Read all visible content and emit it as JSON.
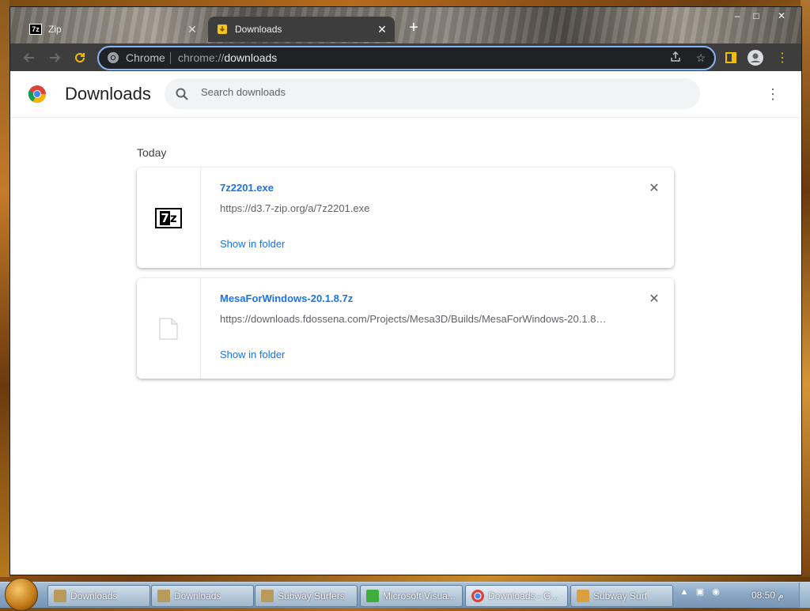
{
  "browser": {
    "tabs": [
      {
        "title": "Zip",
        "active": false
      },
      {
        "title": "Downloads",
        "active": true
      }
    ],
    "new_tab_label": "+",
    "window_controls": {
      "minimize": "–",
      "maximize": "□",
      "close": "✕"
    },
    "omnibox": {
      "scheme_label": "Chrome",
      "url_prefix": "chrome://",
      "url_main": "downloads"
    }
  },
  "page": {
    "title": "Downloads",
    "search_placeholder": "Search downloads",
    "section_label": "Today",
    "downloads": [
      {
        "file_name": "7z2201.exe",
        "url": "https://d3.7-zip.org/a/7z2201.exe",
        "action": "Show in folder",
        "icon": "7zip-icon"
      },
      {
        "file_name": "MesaForWindows-20.1.8.7z",
        "url": "https://downloads.fdossena.com/Projects/Mesa3D/Builds/MesaForWindows-20.1.8…",
        "action": "Show in folder",
        "icon": "generic-file-icon"
      }
    ]
  },
  "taskbar": {
    "buttons": [
      {
        "label": "Downloads",
        "icon": "folder-icon"
      },
      {
        "label": "Downloads",
        "icon": "folder-icon"
      },
      {
        "label": "Subway Surfers",
        "icon": "folder-icon"
      },
      {
        "label": "Microsoft Visua...",
        "icon": "visual-studio-icon"
      },
      {
        "label": "Downloads - G...",
        "icon": "chrome-icon"
      },
      {
        "label": "Subway Surf",
        "icon": "game-icon"
      }
    ],
    "clock": "08:50 م"
  },
  "colors": {
    "link_blue": "#1a73e8",
    "toolbar_dark": "#3d3d3d",
    "focus_ring": "#8ab4f8"
  }
}
